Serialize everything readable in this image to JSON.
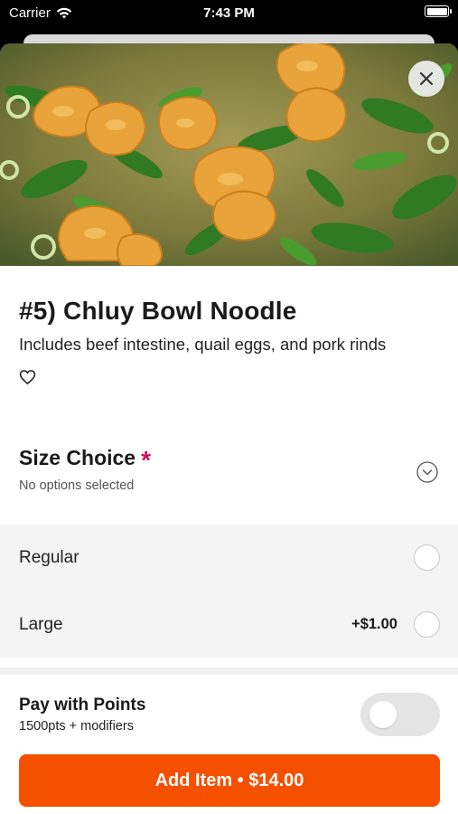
{
  "status": {
    "carrier": "Carrier",
    "time": "7:43 PM"
  },
  "item": {
    "title": "#5) Chluy Bowl Noodle",
    "description": "Includes beef intestine, quail eggs, and pork rinds"
  },
  "size_section": {
    "title": "Size Choice",
    "required_mark": "*",
    "subtitle": "No options selected",
    "options": [
      {
        "label": "Regular",
        "price": ""
      },
      {
        "label": "Large",
        "price": "+$1.00"
      }
    ]
  },
  "points": {
    "title": "Pay with Points",
    "subtitle": "1500pts + modifiers",
    "enabled": false
  },
  "cta": {
    "label": "Add Item • $14.00"
  },
  "colors": {
    "accent": "#f45000",
    "required": "#c2185b"
  },
  "icons": [
    "wifi-icon",
    "battery-icon",
    "close-icon",
    "heart-icon",
    "chevron-down-icon"
  ]
}
